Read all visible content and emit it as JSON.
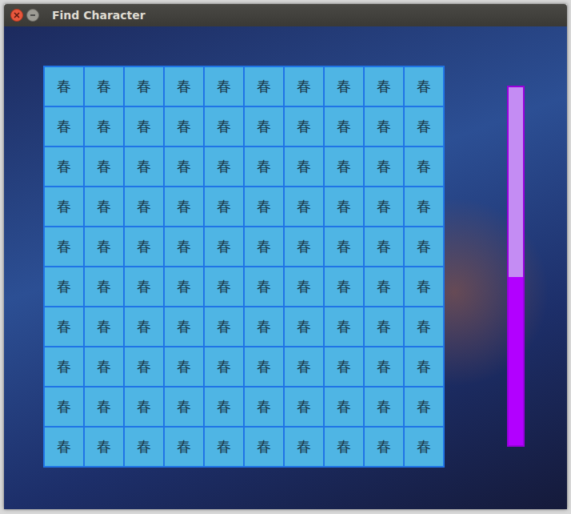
{
  "window": {
    "title": "Find Character"
  },
  "grid": {
    "rows": [
      [
        "春",
        "春",
        "春",
        "春",
        "春",
        "春",
        "春",
        "春",
        "春",
        "春"
      ],
      [
        "春",
        "春",
        "春",
        "春",
        "春",
        "春",
        "春",
        "春",
        "春",
        "春"
      ],
      [
        "春",
        "春",
        "春",
        "春",
        "春",
        "春",
        "春",
        "春",
        "春",
        "春"
      ],
      [
        "春",
        "春",
        "春",
        "春",
        "春",
        "春",
        "春",
        "春",
        "春",
        "春"
      ],
      [
        "春",
        "春",
        "春",
        "春",
        "春",
        "春",
        "春",
        "春",
        "春",
        "春"
      ],
      [
        "春",
        "春",
        "春",
        "春",
        "春",
        "春",
        "春",
        "春",
        "春",
        "春"
      ],
      [
        "春",
        "春",
        "春",
        "春",
        "春",
        "春",
        "春",
        "春",
        "春",
        "春"
      ],
      [
        "春",
        "春",
        "春",
        "春",
        "春",
        "春",
        "春",
        "春",
        "春",
        "春"
      ],
      [
        "春",
        "春",
        "春",
        "春",
        "春",
        "春",
        "春",
        "春",
        "春",
        "春"
      ],
      [
        "春",
        "春",
        "春",
        "春",
        "春",
        "春",
        "春",
        "春",
        "春",
        "春"
      ]
    ]
  },
  "timer": {
    "level": 0.47
  }
}
